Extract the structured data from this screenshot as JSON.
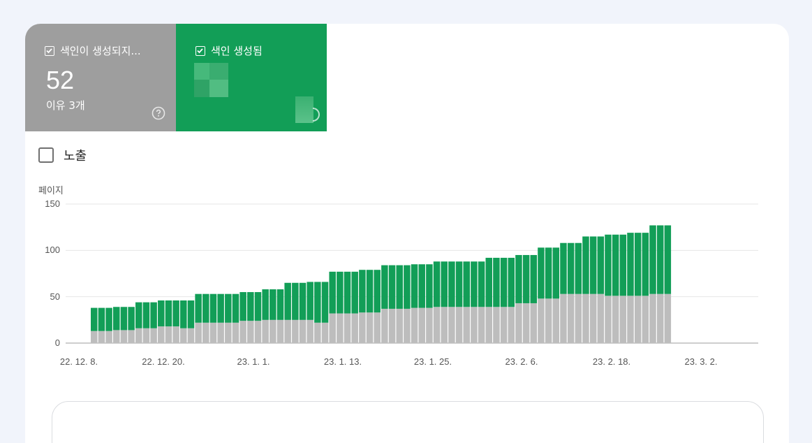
{
  "tiles": [
    {
      "label": "색인이 생성되지...",
      "value": "52",
      "sub": "이유 3개",
      "color": "#9e9e9e",
      "checked": true
    },
    {
      "label": "색인 생성됨",
      "value": "",
      "sub": "",
      "color": "#129e57",
      "checked": true
    }
  ],
  "impressions": {
    "label": "노출",
    "checked": false
  },
  "chart_data": {
    "type": "bar",
    "stacked": true,
    "ylabel": "페이지",
    "ylim": [
      0,
      150
    ],
    "yticks": [
      "0",
      "50",
      "100",
      "150"
    ],
    "xtick_labels": [
      "22. 12. 8.",
      "22. 12. 20.",
      "23. 1. 1.",
      "23. 1. 13.",
      "23. 1. 25.",
      "23. 2. 6.",
      "23. 2. 18.",
      "23. 3. 2."
    ],
    "grid": true,
    "series": [
      {
        "color": "#bdbdbd",
        "values": [
          13,
          13,
          13,
          14,
          14,
          14,
          16,
          16,
          16,
          18,
          18,
          18,
          16,
          16,
          22,
          22,
          22,
          22,
          22,
          22,
          24,
          24,
          24,
          25,
          25,
          25,
          25,
          25,
          25,
          25,
          22,
          22,
          32,
          32,
          32,
          32,
          33,
          33,
          33,
          37,
          37,
          37,
          37,
          38,
          38,
          38,
          39,
          39,
          39,
          39,
          39,
          39,
          39,
          39,
          39,
          39,
          39,
          43,
          43,
          43,
          48,
          48,
          48,
          53,
          53,
          53,
          53,
          53,
          53,
          51,
          51,
          51,
          51,
          51,
          51,
          53,
          53,
          53
        ]
      },
      {
        "color": "#129e57",
        "values": [
          25,
          25,
          25,
          25,
          25,
          25,
          28,
          28,
          28,
          28,
          28,
          28,
          30,
          30,
          31,
          31,
          31,
          31,
          31,
          31,
          31,
          31,
          31,
          33,
          33,
          33,
          40,
          40,
          40,
          41,
          44,
          44,
          45,
          45,
          45,
          45,
          46,
          46,
          46,
          47,
          47,
          47,
          47,
          47,
          47,
          47,
          49,
          49,
          49,
          49,
          49,
          49,
          49,
          53,
          53,
          53,
          53,
          52,
          52,
          52,
          55,
          55,
          55,
          55,
          55,
          55,
          62,
          62,
          62,
          66,
          66,
          66,
          68,
          68,
          68,
          74,
          74,
          74
        ]
      }
    ]
  }
}
